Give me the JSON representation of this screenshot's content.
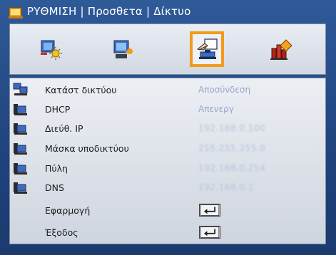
{
  "header": {
    "title": "ΡΥΘΜΙΣΗ | Προσθετα | Δίκτυο"
  },
  "tabs": [
    {
      "icon": "image-settings-icon",
      "active": false
    },
    {
      "icon": "display-settings-icon",
      "active": false
    },
    {
      "icon": "setup-hand-icon",
      "active": true
    },
    {
      "icon": "info-chart-icon",
      "active": false
    }
  ],
  "network": {
    "rows": [
      {
        "label": "Κατάστ δικτύου",
        "value": "Αποσύνδεση",
        "icon": "network-status-icon"
      },
      {
        "label": "DHCP",
        "value": "Απενεργ",
        "icon": "dhcp-icon"
      },
      {
        "label": "Διεύθ. IP",
        "value": "192.168.0.100",
        "icon": "ip-address-icon"
      },
      {
        "label": "Μάσκα υποδικτύου",
        "value": "255.255.255.0",
        "icon": "subnet-mask-icon"
      },
      {
        "label": "Πύλη",
        "value": "192.168.0.254",
        "icon": "gateway-icon"
      },
      {
        "label": "DNS",
        "value": "192.168.0.1",
        "icon": "dns-icon"
      }
    ],
    "apply_label": "Εφαρμογή",
    "exit_label": "Έξοδος"
  },
  "colors": {
    "frame": "#21457f",
    "active_tab_border": "#f39a1c",
    "value_text": "#98a8c8"
  }
}
